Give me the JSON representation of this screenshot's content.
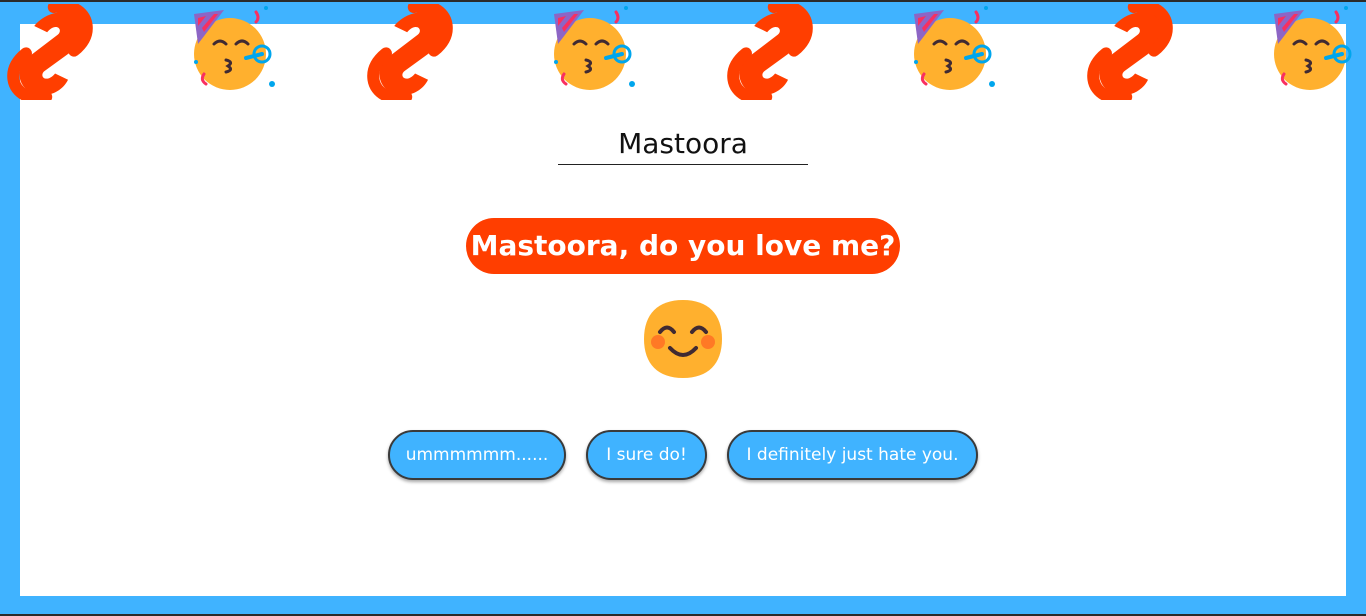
{
  "header": {
    "decorations": [
      "svelte-logo-icon",
      "partying-face-icon",
      "svelte-logo-icon",
      "partying-face-icon",
      "svelte-logo-icon",
      "partying-face-icon",
      "svelte-logo-icon",
      "partying-face-icon"
    ]
  },
  "name_field": {
    "value": "Mastoora"
  },
  "question": {
    "text": "Mastoora, do you love me?"
  },
  "reaction": {
    "icon": "smiling-face-icon"
  },
  "buttons": {
    "maybe_label": "ummmmmm......",
    "yes_label": "I sure do!",
    "no_label": "I definitely just hate you."
  },
  "colors": {
    "frame": "#40b3ff",
    "accent": "#ff3e00",
    "button": "#40b3ff",
    "emoji": "#ffb02e"
  }
}
